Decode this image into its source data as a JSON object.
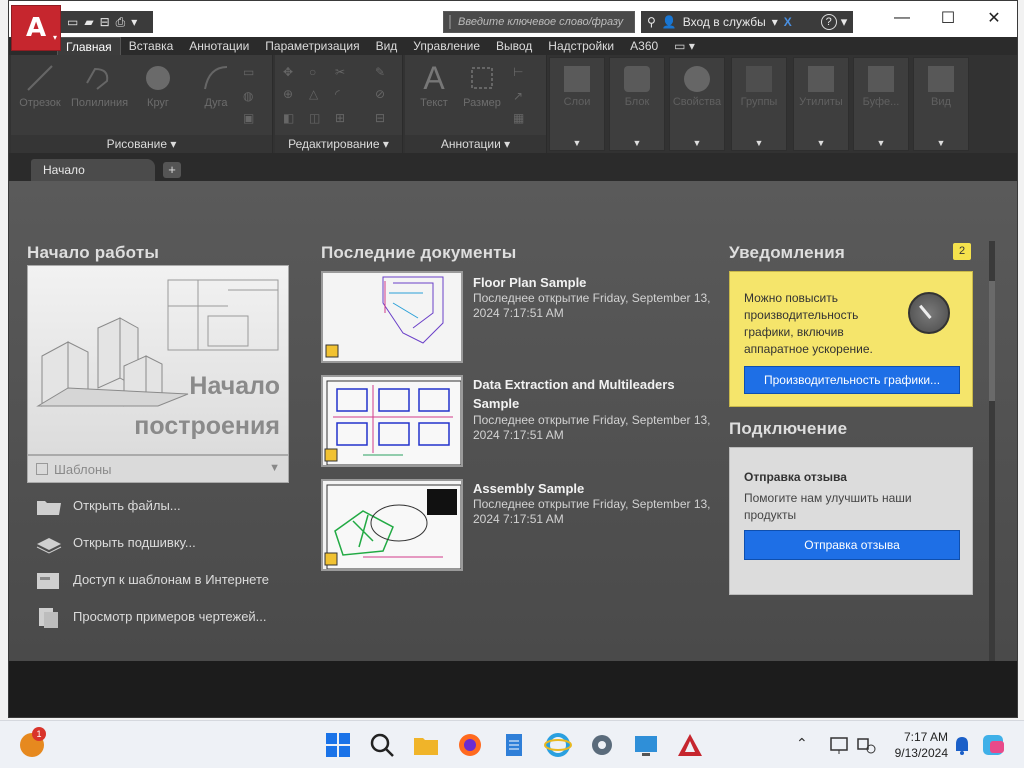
{
  "titlebar": {
    "search_placeholder": "Введите ключевое слово/фразу",
    "signin_label": "Вход в службы",
    "help_label": "?",
    "minimize": "—",
    "maximize": "☐",
    "close": "✕"
  },
  "ribbon": {
    "tabs": [
      "Главная",
      "Вставка",
      "Аннотации",
      "Параметризация",
      "Вид",
      "Управление",
      "Вывод",
      "Надстройки",
      "A360"
    ],
    "active_tab": "Главная",
    "panels": {
      "draw": "Рисование",
      "modify": "Редактирование",
      "annotation": "Аннотации"
    },
    "draw_tools": [
      "Отрезок",
      "Полилиния",
      "Круг",
      "Дуга"
    ],
    "annotation_tools": [
      "Текст",
      "Размер"
    ],
    "grouped_panels": [
      "Слои",
      "Блок",
      "Свойства",
      "Группы",
      "Утилиты",
      "Буфе...",
      "Вид"
    ]
  },
  "file_tabs": {
    "start_tab": "Начало",
    "new_tab": "+"
  },
  "get_started": {
    "heading": "Начало работы",
    "create_line1": "Начало",
    "create_line2": "построения",
    "templates_label": "Шаблоны",
    "actions": [
      "Открыть файлы...",
      "Открыть подшивку...",
      "Доступ к шаблонам в Интернете",
      "Просмотр примеров чертежей..."
    ]
  },
  "recent_documents": {
    "heading": "Последние документы",
    "items": [
      {
        "title": "Floor Plan Sample",
        "meta": "Последнее открытие Friday, September 13, 2024 7:17:51 AM"
      },
      {
        "title": "Data Extraction and Multileaders Sample",
        "meta": "Последнее открытие Friday, September 13, 2024 7:17:51 AM"
      },
      {
        "title": "Assembly Sample",
        "meta": "Последнее открытие Friday, September 13, 2024 7:17:51 AM"
      }
    ]
  },
  "notifications": {
    "heading": "Уведомления",
    "count": "2",
    "message": "Можно повысить производительность графики, включив аппаратное ускорение.",
    "button": "Производительность графики..."
  },
  "connect": {
    "heading": "Подключение",
    "feedback_title": "Отправка отзыва",
    "feedback_text": "Помогите нам улучшить наши продукты",
    "feedback_button": "Отправка отзыва"
  },
  "taskbar": {
    "notification_badge": "1",
    "time": "7:17 AM",
    "date": "9/13/2024"
  },
  "colors": {
    "accent_blue": "#1e6fe6",
    "notif_yellow": "#f5e56b",
    "autocad_red": "#c6262e"
  }
}
